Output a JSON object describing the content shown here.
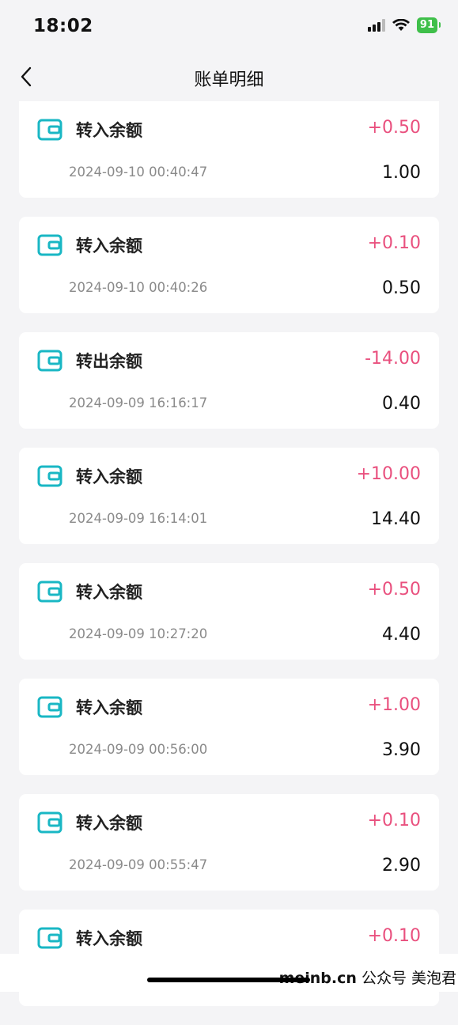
{
  "status_bar": {
    "time": "18:02",
    "battery": "91",
    "icons": [
      "signal-icon",
      "wifi-icon",
      "battery-icon"
    ]
  },
  "nav": {
    "title": "账单明细",
    "back_icon": "chevron-left-icon"
  },
  "colors": {
    "amount": "#e9507e",
    "icon": "#19b7c4"
  },
  "records": [
    {
      "title": "转入余额",
      "amount": "+0.50",
      "time": "2024-09-10 00:40:47",
      "balance": "1.00"
    },
    {
      "title": "转入余额",
      "amount": "+0.10",
      "time": "2024-09-10 00:40:26",
      "balance": "0.50"
    },
    {
      "title": "转出余额",
      "amount": "-14.00",
      "time": "2024-09-09 16:16:17",
      "balance": "0.40"
    },
    {
      "title": "转入余额",
      "amount": "+10.00",
      "time": "2024-09-09 16:14:01",
      "balance": "14.40"
    },
    {
      "title": "转入余额",
      "amount": "+0.50",
      "time": "2024-09-09 10:27:20",
      "balance": "4.40"
    },
    {
      "title": "转入余额",
      "amount": "+1.00",
      "time": "2024-09-09 00:56:00",
      "balance": "3.90"
    },
    {
      "title": "转入余额",
      "amount": "+0.10",
      "time": "2024-09-09 00:55:47",
      "balance": "2.90"
    },
    {
      "title": "转入余额",
      "amount": "+0.10",
      "time": "",
      "balance": ""
    }
  ],
  "watermark": {
    "site": "meinb.cn",
    "text": "公众号 美泡君"
  }
}
